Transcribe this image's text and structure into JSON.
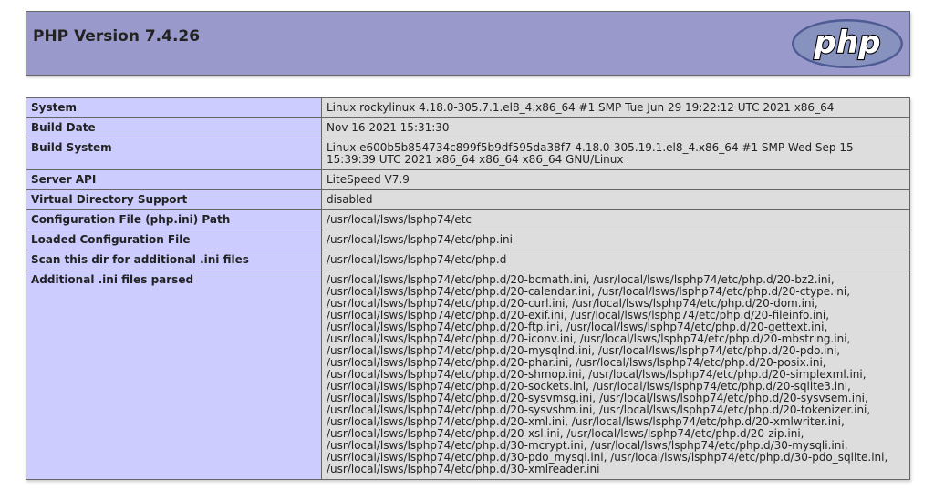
{
  "header": {
    "title": "PHP Version 7.4.26",
    "logo_text": "php"
  },
  "colors": {
    "header_bg": "#9999cc",
    "label_bg": "#ccccff",
    "value_bg": "#dddddd",
    "border": "#666666",
    "logo_fill": "#6c7eb7"
  },
  "rows": [
    {
      "label": "System",
      "value": "Linux rockylinux 4.18.0-305.7.1.el8_4.x86_64 #1 SMP Tue Jun 29 19:22:12 UTC 2021 x86_64"
    },
    {
      "label": "Build Date",
      "value": "Nov 16 2021 15:31:30"
    },
    {
      "label": "Build System",
      "value": "Linux e600b5b854734c899f5b9df595da38f7 4.18.0-305.19.1.el8_4.x86_64 #1 SMP Wed Sep 15 15:39:39 UTC 2021 x86_64 x86_64 x86_64 GNU/Linux"
    },
    {
      "label": "Server API",
      "value": "LiteSpeed V7.9"
    },
    {
      "label": "Virtual Directory Support",
      "value": "disabled"
    },
    {
      "label": "Configuration File (php.ini) Path",
      "value": "/usr/local/lsws/lsphp74/etc"
    },
    {
      "label": "Loaded Configuration File",
      "value": "/usr/local/lsws/lsphp74/etc/php.ini"
    },
    {
      "label": "Scan this dir for additional .ini files",
      "value": "/usr/local/lsws/lsphp74/etc/php.d"
    },
    {
      "label": "Additional .ini files parsed",
      "value": "/usr/local/lsws/lsphp74/etc/php.d/20-bcmath.ini, /usr/local/lsws/lsphp74/etc/php.d/20-bz2.ini,\n/usr/local/lsws/lsphp74/etc/php.d/20-calendar.ini, /usr/local/lsws/lsphp74/etc/php.d/20-ctype.ini,\n/usr/local/lsws/lsphp74/etc/php.d/20-curl.ini, /usr/local/lsws/lsphp74/etc/php.d/20-dom.ini,\n/usr/local/lsws/lsphp74/etc/php.d/20-exif.ini, /usr/local/lsws/lsphp74/etc/php.d/20-fileinfo.ini,\n/usr/local/lsws/lsphp74/etc/php.d/20-ftp.ini, /usr/local/lsws/lsphp74/etc/php.d/20-gettext.ini,\n/usr/local/lsws/lsphp74/etc/php.d/20-iconv.ini, /usr/local/lsws/lsphp74/etc/php.d/20-mbstring.ini,\n/usr/local/lsws/lsphp74/etc/php.d/20-mysqlnd.ini, /usr/local/lsws/lsphp74/etc/php.d/20-pdo.ini,\n/usr/local/lsws/lsphp74/etc/php.d/20-phar.ini, /usr/local/lsws/lsphp74/etc/php.d/20-posix.ini,\n/usr/local/lsws/lsphp74/etc/php.d/20-shmop.ini, /usr/local/lsws/lsphp74/etc/php.d/20-simplexml.ini,\n/usr/local/lsws/lsphp74/etc/php.d/20-sockets.ini, /usr/local/lsws/lsphp74/etc/php.d/20-sqlite3.ini,\n/usr/local/lsws/lsphp74/etc/php.d/20-sysvmsg.ini, /usr/local/lsws/lsphp74/etc/php.d/20-sysvsem.ini,\n/usr/local/lsws/lsphp74/etc/php.d/20-sysvshm.ini, /usr/local/lsws/lsphp74/etc/php.d/20-tokenizer.ini,\n/usr/local/lsws/lsphp74/etc/php.d/20-xml.ini, /usr/local/lsws/lsphp74/etc/php.d/20-xmlwriter.ini,\n/usr/local/lsws/lsphp74/etc/php.d/20-xsl.ini, /usr/local/lsws/lsphp74/etc/php.d/20-zip.ini,\n/usr/local/lsws/lsphp74/etc/php.d/30-mcrypt.ini, /usr/local/lsws/lsphp74/etc/php.d/30-mysqli.ini,\n/usr/local/lsws/lsphp74/etc/php.d/30-pdo_mysql.ini, /usr/local/lsws/lsphp74/etc/php.d/30-pdo_sqlite.ini,\n/usr/local/lsws/lsphp74/etc/php.d/30-xmlreader.ini"
    }
  ]
}
